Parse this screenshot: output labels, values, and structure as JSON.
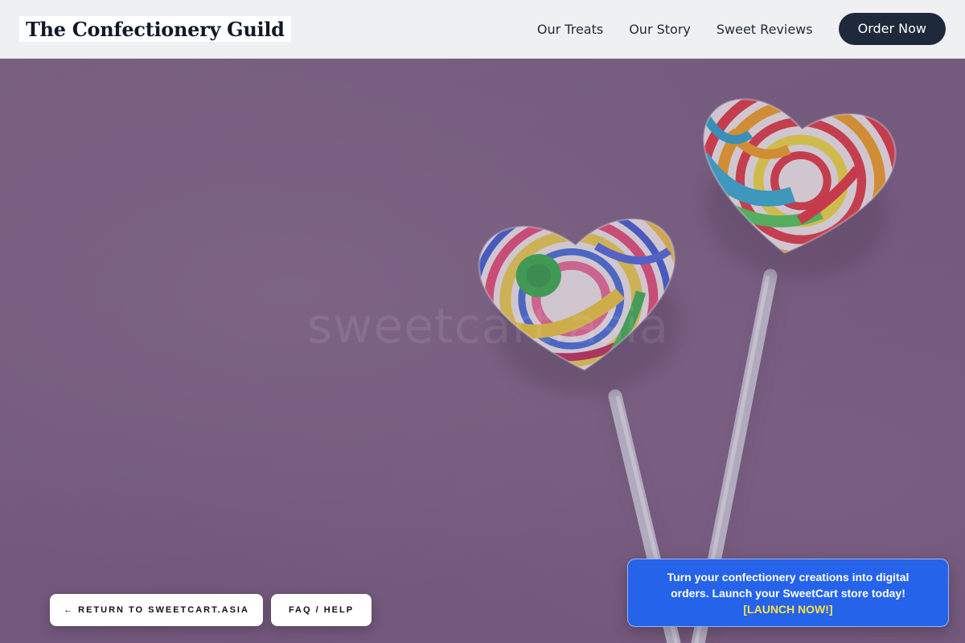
{
  "header": {
    "brand": "The Confectionery Guild",
    "nav": [
      "Our Treats",
      "Our Story",
      "Sweet Reviews"
    ],
    "cta_label": "Order Now"
  },
  "hero": {
    "watermark": "sweetcart.asia",
    "image_description_icon": "heart-lollipops-icon"
  },
  "footer_buttons": {
    "return_label": "← RETURN TO SWEETCART.ASIA",
    "faq_label": "FAQ / HELP"
  },
  "promo": {
    "text": "Turn your confectionery creations into digital orders. Launch your SweetCart store today!",
    "link_label": "[LAUNCH NOW!]"
  },
  "colors": {
    "header_bg": "#eff0f2",
    "hero_bg": "#795f82",
    "cta_bg": "#1e293b",
    "promo_bg": "#2563eb",
    "promo_link": "#fde047"
  }
}
